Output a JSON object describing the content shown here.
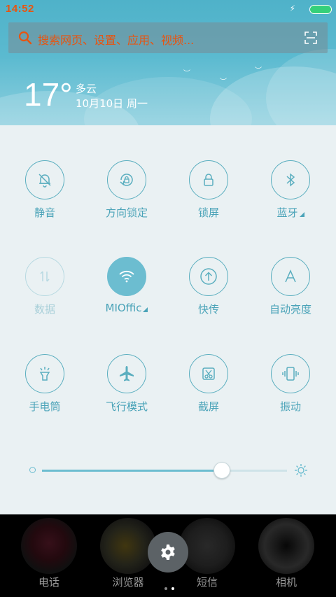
{
  "status": {
    "time": "14:52"
  },
  "search": {
    "placeholder": "搜索网页、设置、应用、视频..."
  },
  "weather": {
    "temperature": "17°",
    "condition": "多云",
    "date": "10月10日 周一"
  },
  "tiles": [
    {
      "label": "静音",
      "icon": "bell-off-icon",
      "state": "normal"
    },
    {
      "label": "方向锁定",
      "icon": "rotation-lock-icon",
      "state": "normal"
    },
    {
      "label": "锁屏",
      "icon": "lock-icon",
      "state": "normal"
    },
    {
      "label": "蓝牙",
      "icon": "bluetooth-icon",
      "state": "normal",
      "has_menu": true
    },
    {
      "label": "数据",
      "icon": "data-arrows-icon",
      "state": "disabled"
    },
    {
      "label": "MIOffic",
      "icon": "wifi-icon",
      "state": "active",
      "has_menu": true
    },
    {
      "label": "快传",
      "icon": "upload-icon",
      "state": "normal"
    },
    {
      "label": "自动亮度",
      "icon": "auto-brightness-icon",
      "state": "normal"
    },
    {
      "label": "手电筒",
      "icon": "flashlight-icon",
      "state": "normal"
    },
    {
      "label": "飞行模式",
      "icon": "airplane-icon",
      "state": "normal"
    },
    {
      "label": "截屏",
      "icon": "scissors-icon",
      "state": "normal"
    },
    {
      "label": "振动",
      "icon": "vibrate-icon",
      "state": "normal"
    }
  ],
  "brightness": {
    "level": 0.73
  },
  "dock": [
    {
      "label": "电话",
      "icon": "phone-icon"
    },
    {
      "label": "浏览器",
      "icon": "browser-icon"
    },
    {
      "label": "短信",
      "icon": "messages-icon"
    },
    {
      "label": "相机",
      "icon": "camera-icon"
    }
  ],
  "colors": {
    "accent": "#4aa3b8",
    "active": "#6cbdd0",
    "search_text": "#e8540f",
    "panel": "#eaf1f3"
  }
}
